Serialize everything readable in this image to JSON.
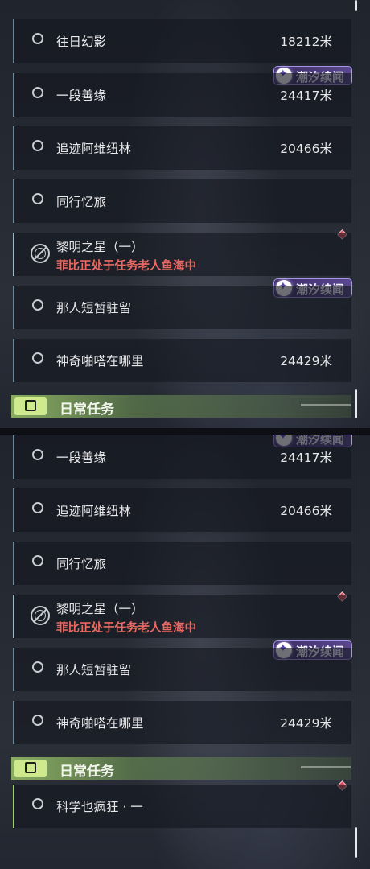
{
  "top": {
    "rows": [
      {
        "title": "往日幻影",
        "distance": "18212米"
      },
      {
        "title": "一段善缘",
        "distance": "24417米"
      },
      {
        "title": "追迹阿维纽林",
        "distance": "20466米"
      },
      {
        "title": "同行忆旅",
        "distance": ""
      },
      {
        "title": "黎明之星（一）",
        "subtitle": "菲比正处于任务老人鱼海中"
      },
      {
        "title": "那人短暂驻留",
        "distance": ""
      },
      {
        "title": "神奇啪嗒在哪里",
        "distance": "24429米"
      }
    ],
    "badge_text": "潮汐续闻",
    "section_title": "日常任务"
  },
  "bottom": {
    "rows": [
      {
        "title": "一段善缘",
        "distance": "24417米"
      },
      {
        "title": "追迹阿维纽林",
        "distance": "20466米"
      },
      {
        "title": "同行忆旅",
        "distance": ""
      },
      {
        "title": "黎明之星（一）",
        "subtitle": "菲比正处于任务老人鱼海中"
      },
      {
        "title": "那人短暂驻留",
        "distance": ""
      },
      {
        "title": "神奇啪嗒在哪里",
        "distance": "24429米"
      },
      {
        "title": "科学也疯狂 · 一",
        "distance": ""
      }
    ],
    "badge_text": "潮汐续闻",
    "section_title": "日常任务"
  },
  "colors": {
    "accent_daily": "#9fce6c",
    "badge_purple": "#5a4790",
    "tracking_red": "#e86a63",
    "gem_red": "#e04b58"
  },
  "icons": [
    "quest-circle-icon",
    "tracking-target-icon",
    "tide-story-icon",
    "daily-quest-icon",
    "diamond-marker-icon"
  ]
}
